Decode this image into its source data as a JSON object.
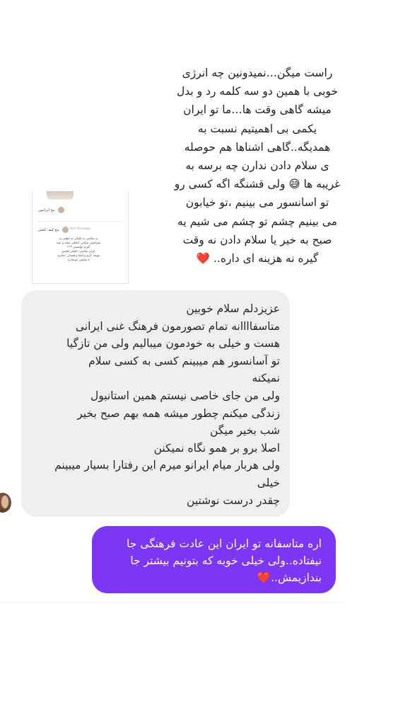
{
  "embedded_screenshot": {
    "user_one": "پیج ایرانتون",
    "divider": "New Messages",
    "user_two": "پیج کیف کفش",
    "message": "یه سلامی یه علیکی یه لطفی یه\nمتواضعی میکنی. اتفاقی بیفته و بقیه\nگیرم دولشش ؟!!!\nایران سلامی، علیکی هایش\nمهمه. گرم و آشنا و همدلی حجازی\nبا سلیقی مونجاره."
  },
  "caption_message": "راست میگن…نمیدونین چه انرژی\nخوبی با همین دو سه کلمه رد و بدل\nمیشه گاهی وقت ها…ما تو ایران\nیکمی بی اهمیتیم نسبت به\nهمدیگه..گاهی اشناها هم حوصله\nی سلام دادن ندارن چه برسه به\nغریبه ها 😅 ولی قشنگه اگه کسی رو\nتو اسانسور می بینیم ،تو خیابون\nمی بینیم چشم تو چشم می شیم یه\nصبح به خیر یا سلام دادن نه وقت\nگیره نه هزینه ای داره..",
  "caption_heart": "❤️",
  "incoming_message": "عزیزدلم سلام خوبین\nمتاسفاااانه تمام تصورمون فرهنگ غنی ایرانی\nهست و خیلی به خودمون میبالیم ولی من تازگیا\nتو آسانسور هم میبینم کسی به کسی سلام\nنمیکنه\nولی من جای خاصی نیستم همین استانبول\nزندگی میکنم چطور میشه همه بهم صبح بخیر\nشب بخیر میگن\nاصلا برو بر همو نگاه نمیکنن\nولی هربار میام ایرانو میرم این رفتارا بسیار میبینم\nخیلی\nچقدر درست نوشتین",
  "outgoing_message": "اره متاسفانه تو ایران این عادت فرهنگی جا\nنیفتاده..ولی خیلی خوبه که بتونیم بیشتر جا\nبندازیمش..",
  "outgoing_heart": "❤️",
  "colors": {
    "incoming_bubble": "#efefef",
    "outgoing_bubble": "#7d36f3",
    "heart": "#e0102c"
  }
}
